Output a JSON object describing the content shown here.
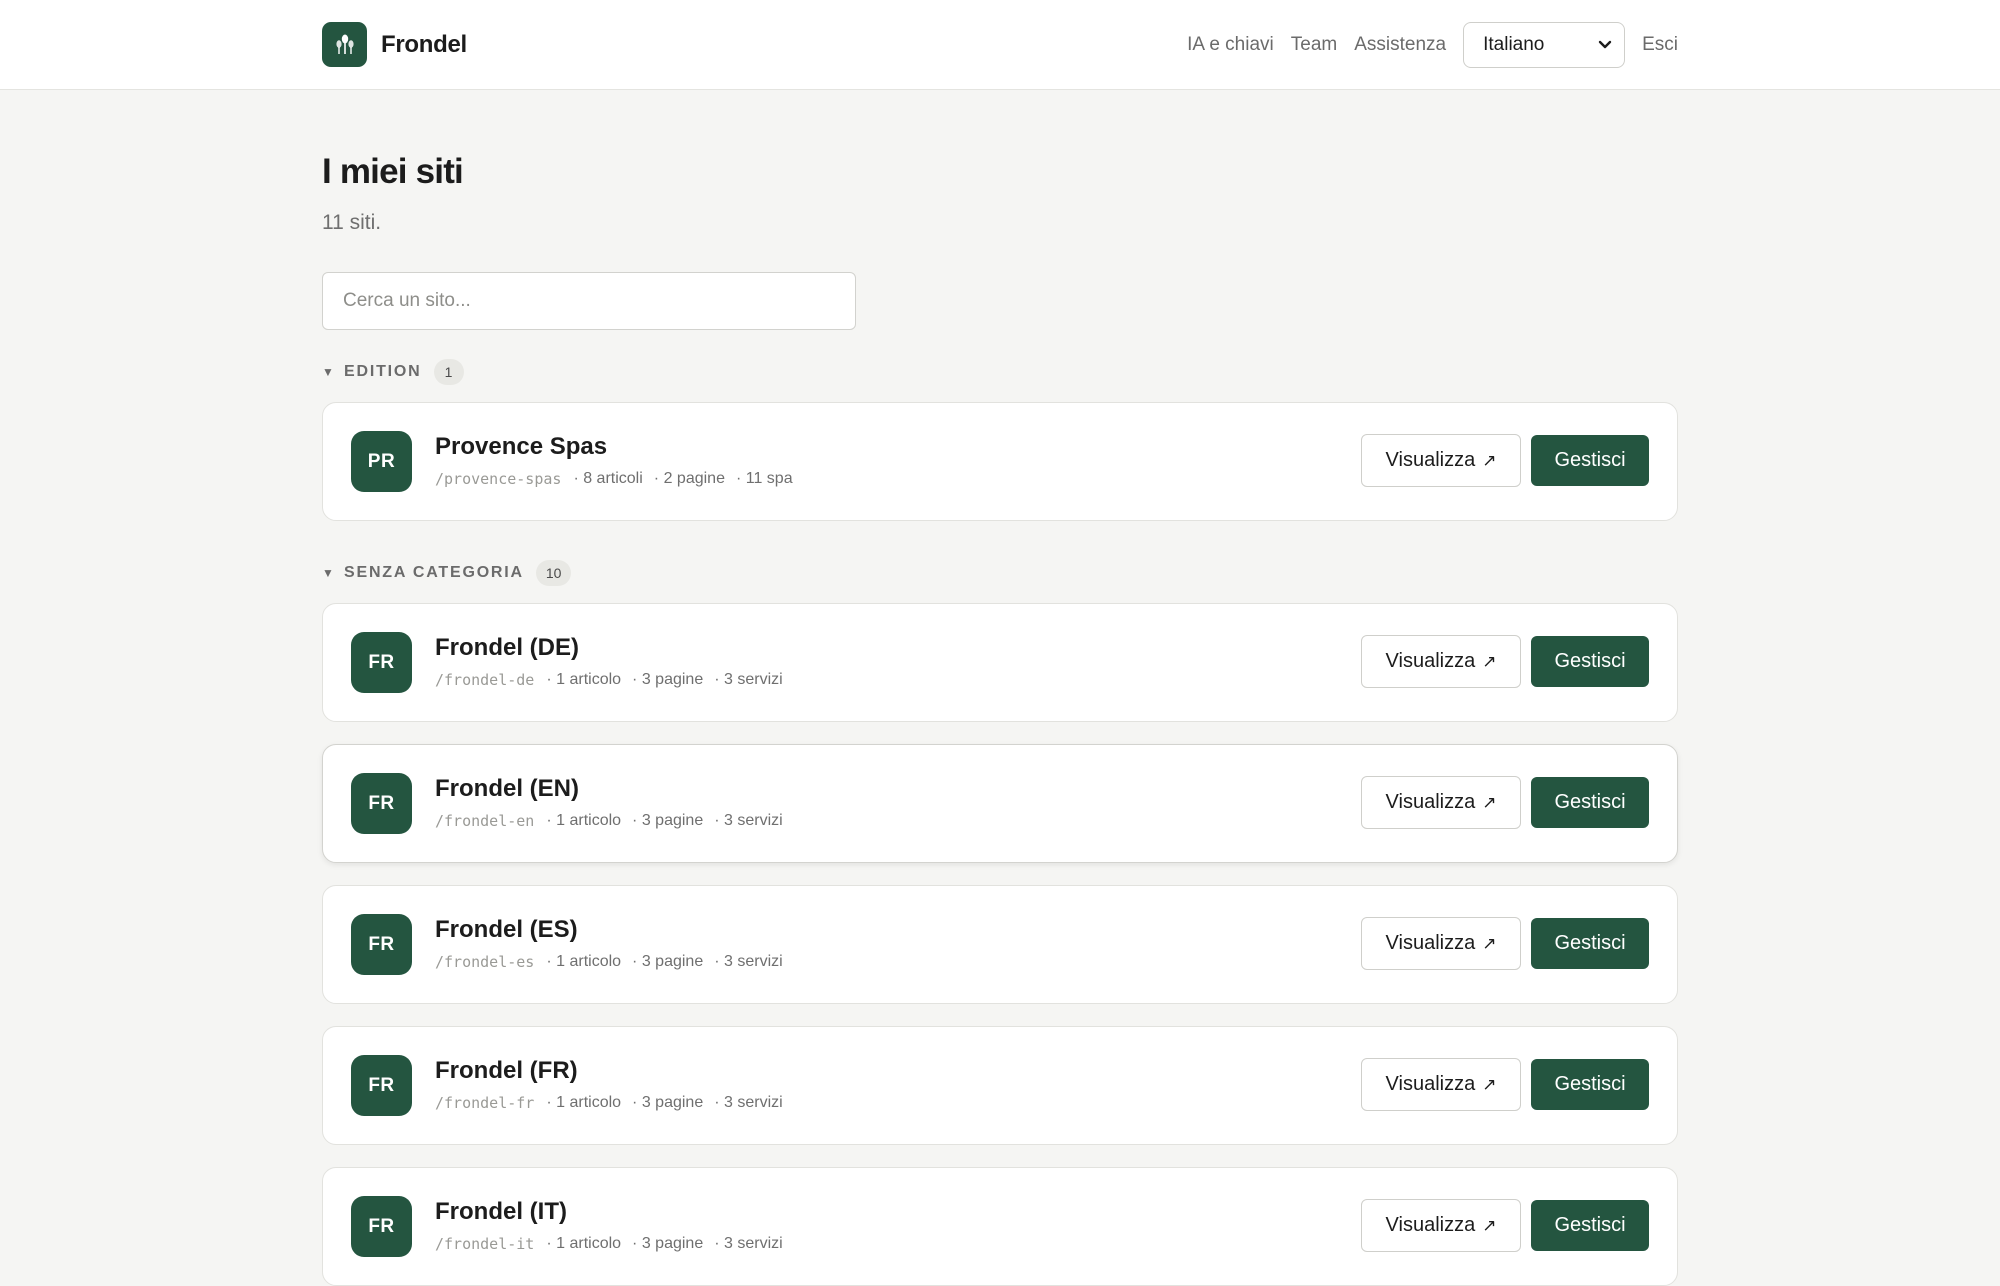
{
  "header": {
    "brand_name": "Frondel",
    "nav": [
      {
        "label": "IA e chiavi"
      },
      {
        "label": "Team"
      },
      {
        "label": "Assistenza"
      }
    ],
    "language": "Italiano",
    "logout_label": "Esci"
  },
  "main": {
    "title": "I miei siti",
    "subtitle": "11 siti.",
    "search_placeholder": "Cerca un sito...",
    "view_label": "Visualizza",
    "manage_label": "Gestisci"
  },
  "groups": [
    {
      "label": "EDITION",
      "count": "1",
      "sites": [
        {
          "initials": "PR",
          "name": "Provence Spas",
          "slug": "/provence-spas",
          "meta": [
            "· 8 articoli",
            "· 2 pagine",
            "· 11 spa"
          ]
        }
      ]
    },
    {
      "label": "SENZA CATEGORIA",
      "count": "10",
      "sites": [
        {
          "initials": "FR",
          "name": "Frondel (DE)",
          "slug": "/frondel-de",
          "meta": [
            "· 1 articolo",
            "· 3 pagine",
            "· 3 servizi"
          ]
        },
        {
          "initials": "FR",
          "name": "Frondel (EN)",
          "slug": "/frondel-en",
          "meta": [
            "· 1 articolo",
            "· 3 pagine",
            "· 3 servizi"
          ]
        },
        {
          "initials": "FR",
          "name": "Frondel (ES)",
          "slug": "/frondel-es",
          "meta": [
            "· 1 articolo",
            "· 3 pagine",
            "· 3 servizi"
          ]
        },
        {
          "initials": "FR",
          "name": "Frondel (FR)",
          "slug": "/frondel-fr",
          "meta": [
            "· 1 articolo",
            "· 3 pagine",
            "· 3 servizi"
          ]
        },
        {
          "initials": "FR",
          "name": "Frondel (IT)",
          "slug": "/frondel-it",
          "meta": [
            "· 1 articolo",
            "· 3 pagine",
            "· 3 servizi"
          ]
        }
      ]
    }
  ],
  "colors": {
    "brand": "#245540",
    "background": "#f5f5f3",
    "muted_text": "#6f6f6f"
  }
}
